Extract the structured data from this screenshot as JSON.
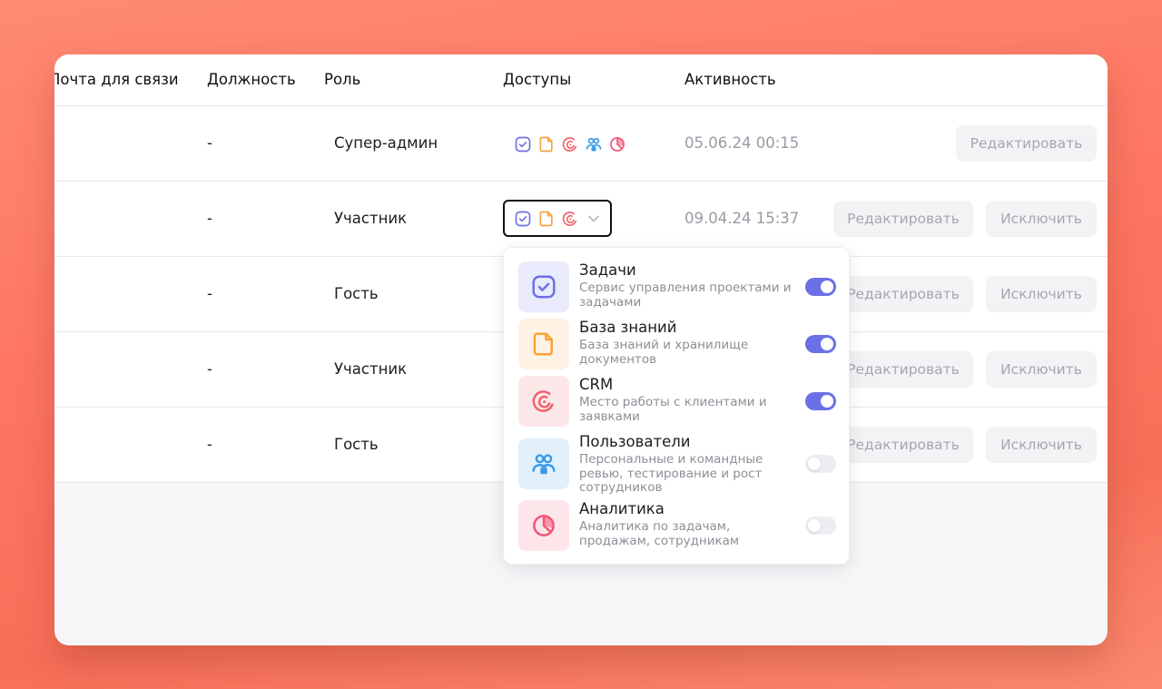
{
  "headers": {
    "email": "Почта для связи",
    "position": "Должность",
    "role": "Роль",
    "access": "Доступы",
    "activity": "Активность"
  },
  "rows": [
    {
      "position": "-",
      "role": "Супер-админ",
      "activity": "05.06.24 00:15",
      "edit": "Редактировать",
      "exclude": ""
    },
    {
      "position": "-",
      "role": "Участник",
      "activity": "09.04.24 15:37",
      "edit": "Редактировать",
      "exclude": "Исключить"
    },
    {
      "position": "-",
      "role": "Гость",
      "activity": "",
      "edit": "Редактировать",
      "exclude": "Исключить"
    },
    {
      "position": "-",
      "role": "Участник",
      "activity": "",
      "edit": "Редактировать",
      "exclude": "Исключить"
    },
    {
      "position": "-",
      "role": "Гость",
      "activity": "",
      "edit": "Редактировать",
      "exclude": "Исключить"
    }
  ],
  "popup": {
    "items": [
      {
        "title": "Задачи",
        "desc": "Сервис управления проектами и задачами",
        "enabled": true,
        "icon": "tasks-icon",
        "color": "#6c70e6"
      },
      {
        "title": "База знаний",
        "desc": "База знаний и хранилище документов",
        "enabled": true,
        "icon": "document-icon",
        "color": "#f6a33b"
      },
      {
        "title": "CRM",
        "desc": "Место работы с клиентами и заявками",
        "enabled": true,
        "icon": "crm-icon",
        "color": "#f0626c"
      },
      {
        "title": "Пользователи",
        "desc": "Персональные и командные ревью, тестирование и рост сотрудников",
        "enabled": false,
        "icon": "users-icon",
        "color": "#3b9be8"
      },
      {
        "title": "Аналитика",
        "desc": "Аналитика по задачам, продажам, сотрудникам",
        "enabled": false,
        "icon": "analytics-icon",
        "color": "#f25476"
      }
    ]
  },
  "colors": {
    "accent": "#6c70e6",
    "tasks": "#6c70e6",
    "docs": "#f6a33b",
    "crm": "#f0626c",
    "users": "#3b9be8",
    "analytics": "#f25476"
  }
}
